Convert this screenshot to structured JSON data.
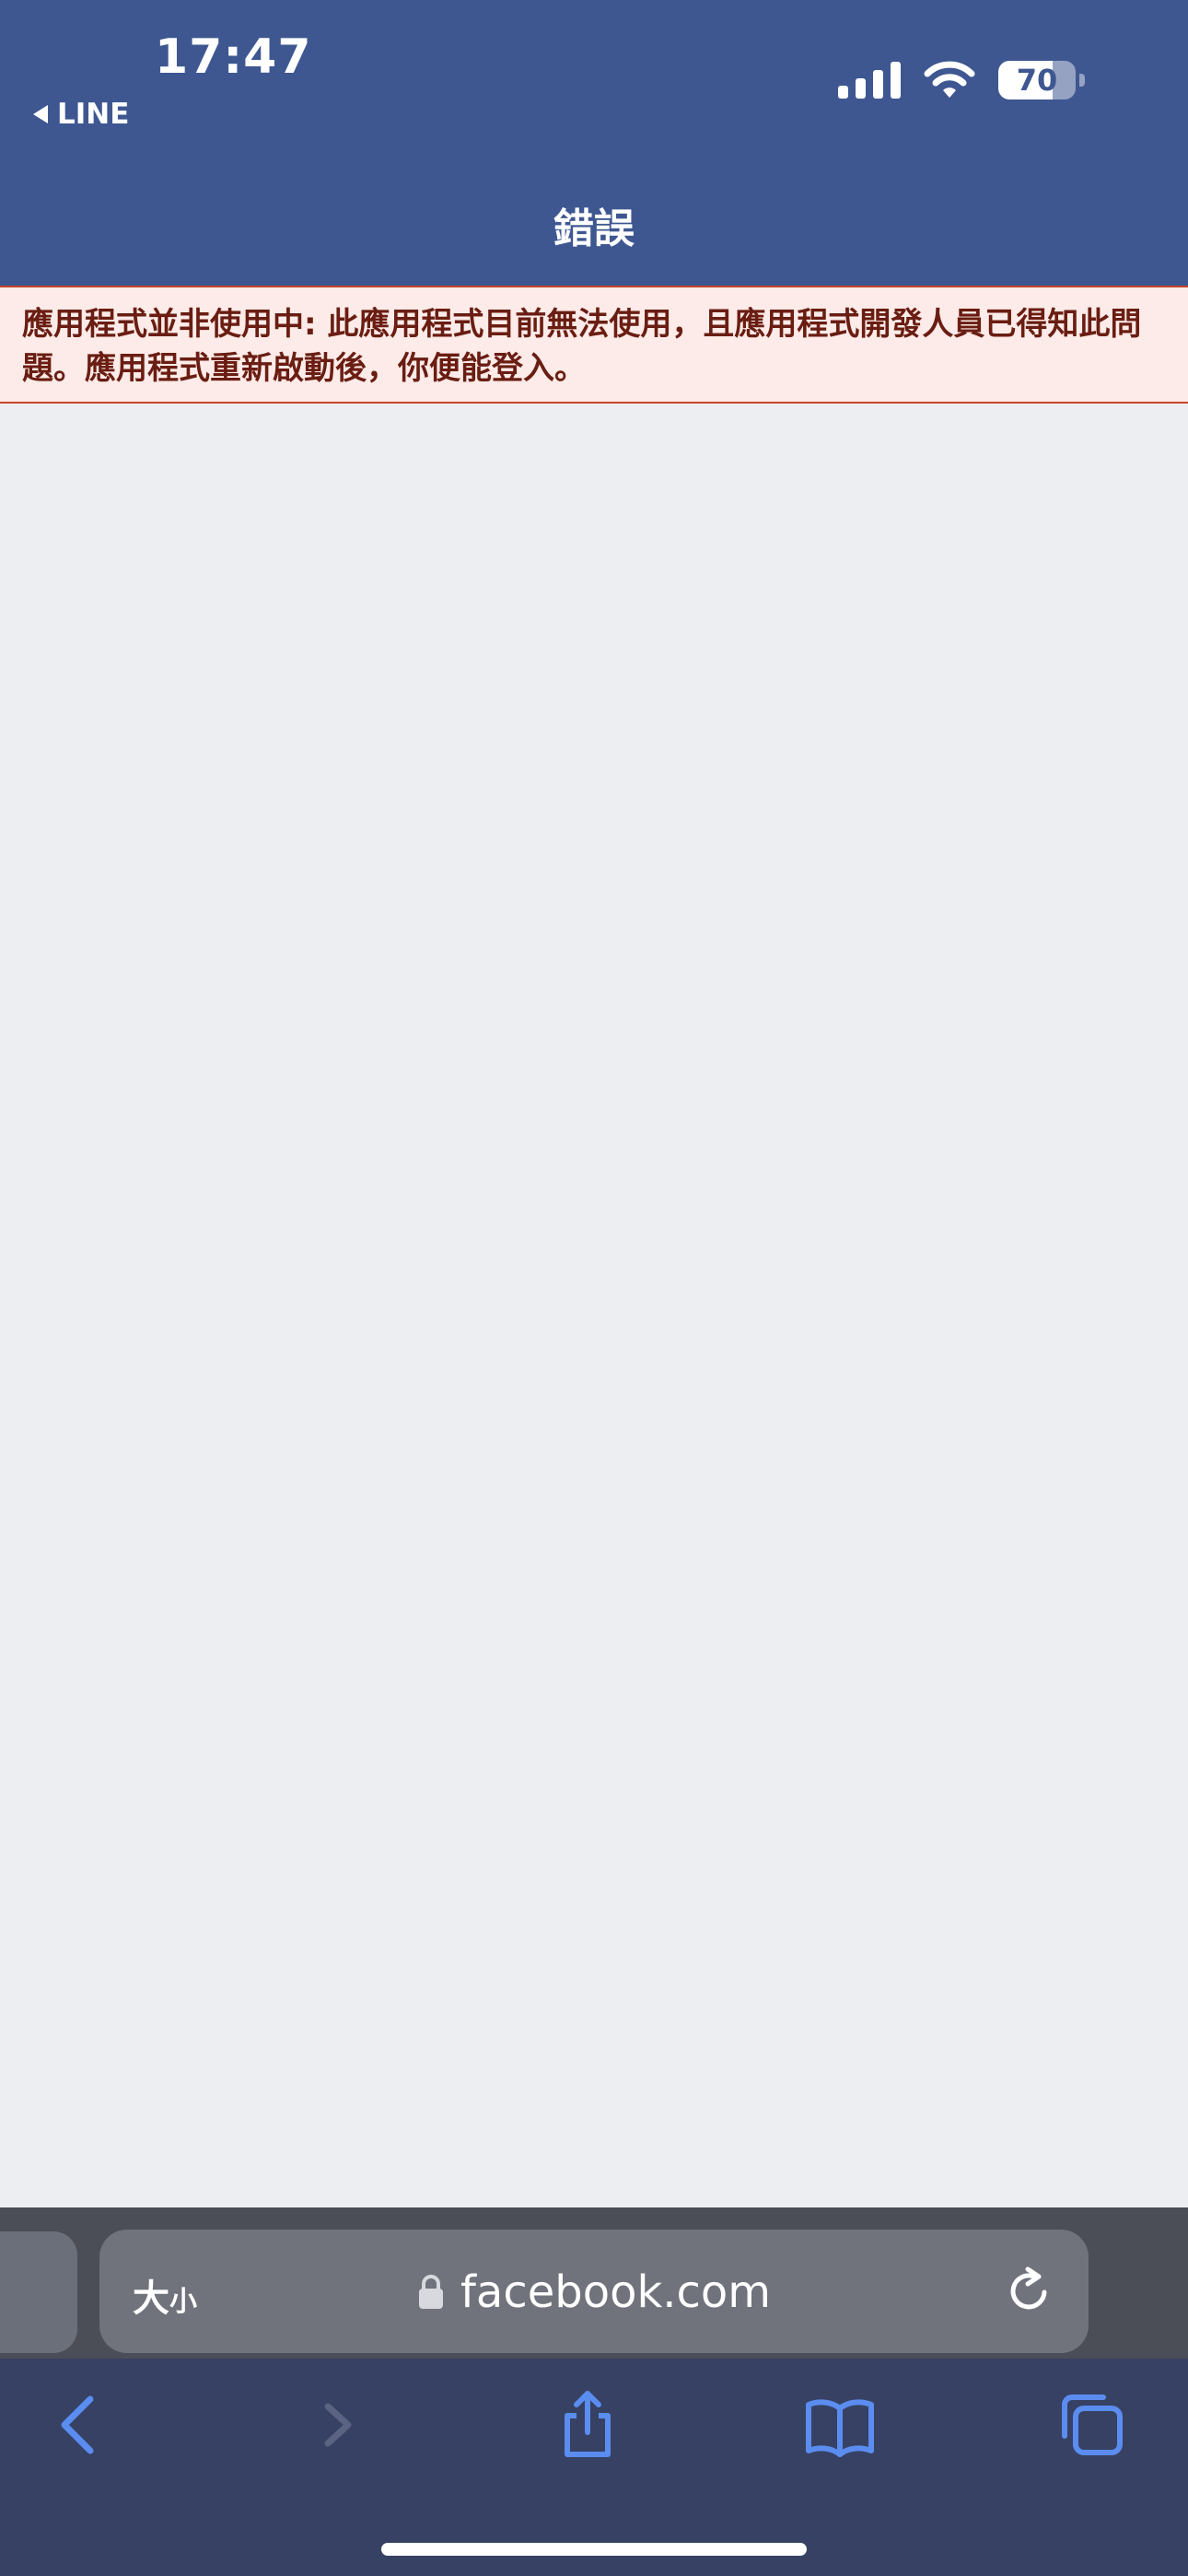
{
  "status_bar": {
    "time": "17:47",
    "back_app": "LINE",
    "battery_level": "70"
  },
  "header": {
    "title": "錯誤"
  },
  "error_banner": {
    "message": "應用程式並非使用中: 此應用程式目前無法使用，且應用程式開發人員已得知此問題。應用程式重新啟動後，你便能登入。"
  },
  "browser": {
    "text_size_big": "大",
    "text_size_small": "小",
    "url": "facebook.com"
  },
  "icons": {
    "back": "chevron-left-icon",
    "forward": "chevron-right-icon",
    "share": "share-icon",
    "bookmarks": "book-icon",
    "tabs": "tabs-icon",
    "lock": "lock-icon",
    "reload": "reload-icon"
  },
  "colors": {
    "header_bg": "#3e5791",
    "error_bg": "#fcebe8",
    "error_border": "#c7442d",
    "error_text": "#6a1d12",
    "page_bg": "#eceef2",
    "toolbar_bg": "#364163",
    "toolbar_icon": "#5b8cf0"
  }
}
